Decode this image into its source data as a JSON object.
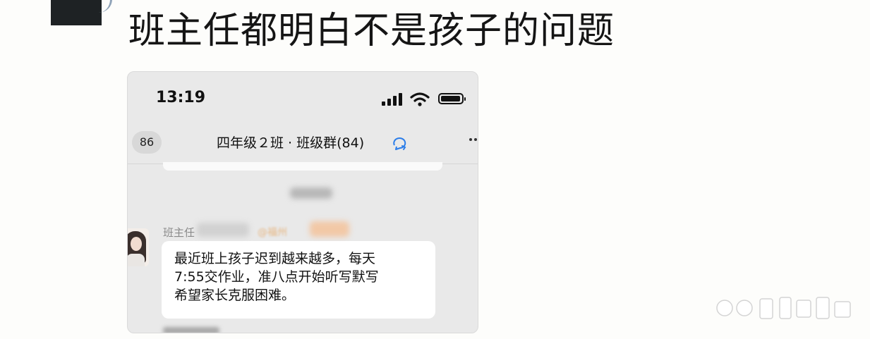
{
  "post": {
    "title": "班主任都明白不是孩子的问题"
  },
  "phone": {
    "status_bar": {
      "time": "13:19",
      "icons": [
        "cellular-signal-icon",
        "wifi-icon",
        "battery-icon"
      ]
    },
    "chat_header": {
      "back_badge": "86",
      "title": "四年级２班 · 班级群(84)",
      "title_icon": "chat-sync-icon",
      "more_icon": "more-icon"
    },
    "message": {
      "sender_name": "班主任",
      "mention": "@福州",
      "lines": [
        "最近班上孩子迟到越来越多，每天",
        "7:55交作业，准八点开始听写默写",
        "希望家长克服困难。"
      ]
    }
  },
  "colors": {
    "page_background": "#fdfdfb",
    "phone_background": "#e9e9e9",
    "bubble_background": "#ffffff",
    "mention_color": "#e6b886"
  }
}
